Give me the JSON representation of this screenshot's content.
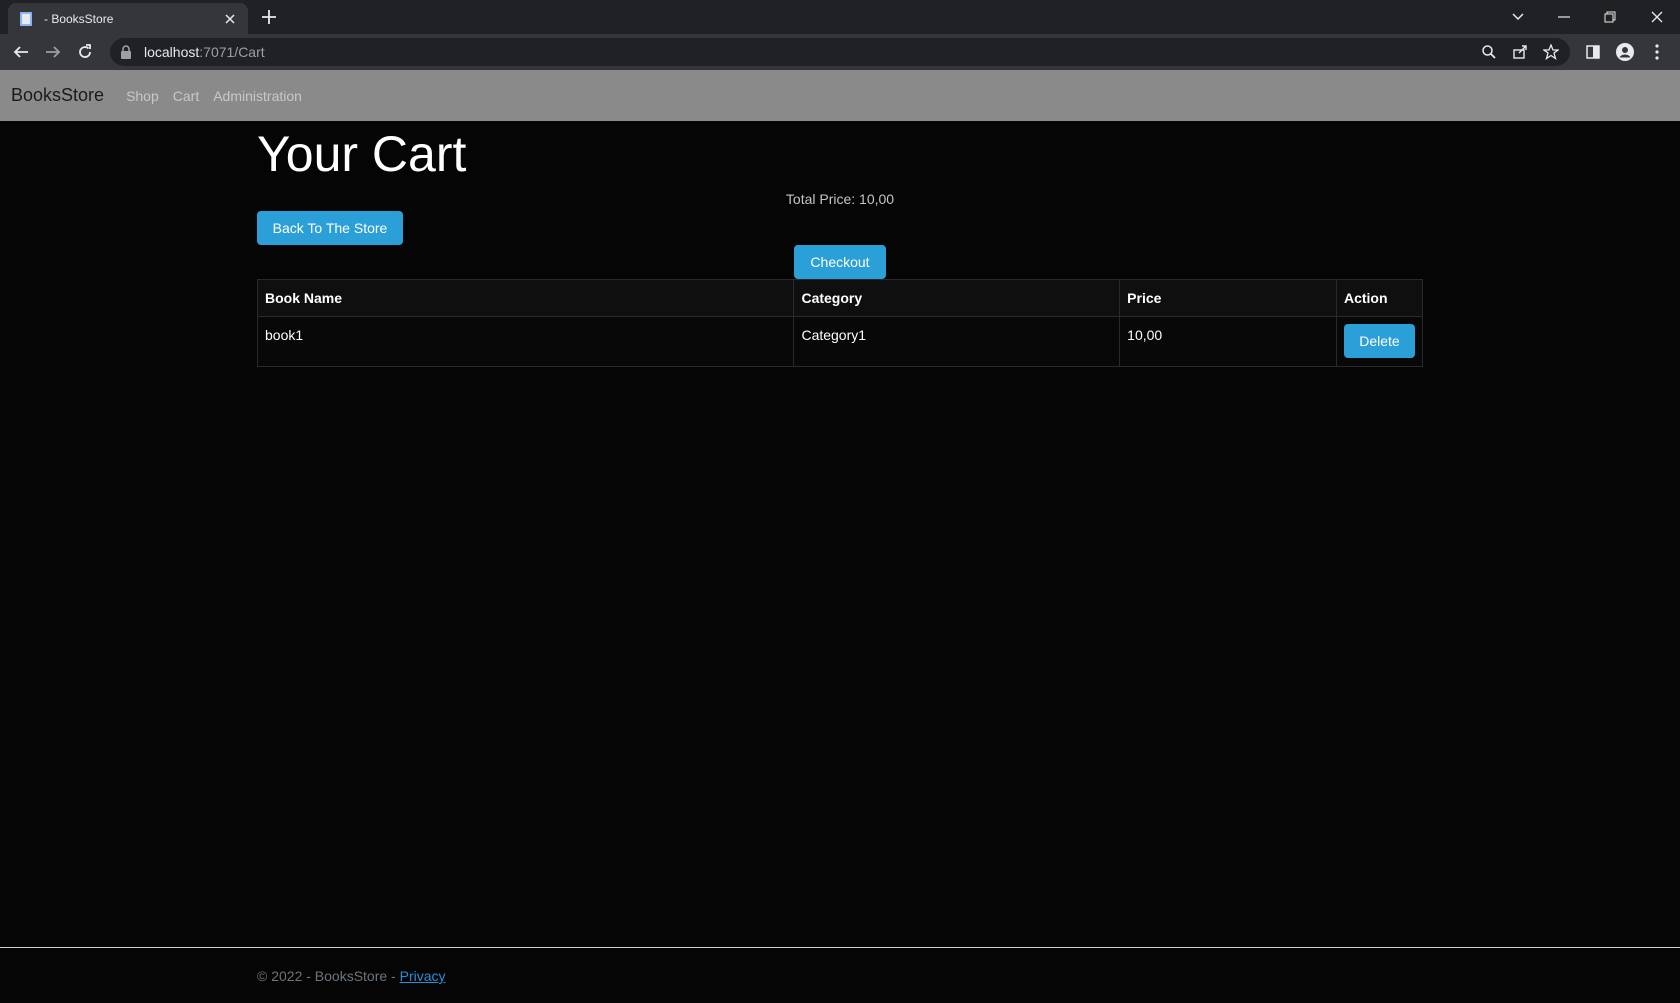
{
  "browser": {
    "tab_title": "- BooksStore",
    "url_host": "localhost",
    "url_path": ":7071/Cart"
  },
  "navbar": {
    "brand": "BooksStore",
    "links": [
      "Shop",
      "Cart",
      "Administration"
    ]
  },
  "main": {
    "title": "Your Cart",
    "total_price": "Total Price: 10,00",
    "back_button": "Back To The Store",
    "checkout_button": "Checkout",
    "table": {
      "headers": [
        "Book Name",
        "Category",
        "Price",
        "Action"
      ],
      "rows": [
        {
          "book_name": "book1",
          "category": "Category1",
          "price": "10,00",
          "action": "Delete"
        }
      ]
    }
  },
  "footer": {
    "text": "© 2022 - BooksStore - ",
    "privacy_link": "Privacy"
  },
  "colors": {
    "accent": "#2b9fd8",
    "navbar_bg": "#8a8a8a",
    "page_bg": "#050505"
  }
}
